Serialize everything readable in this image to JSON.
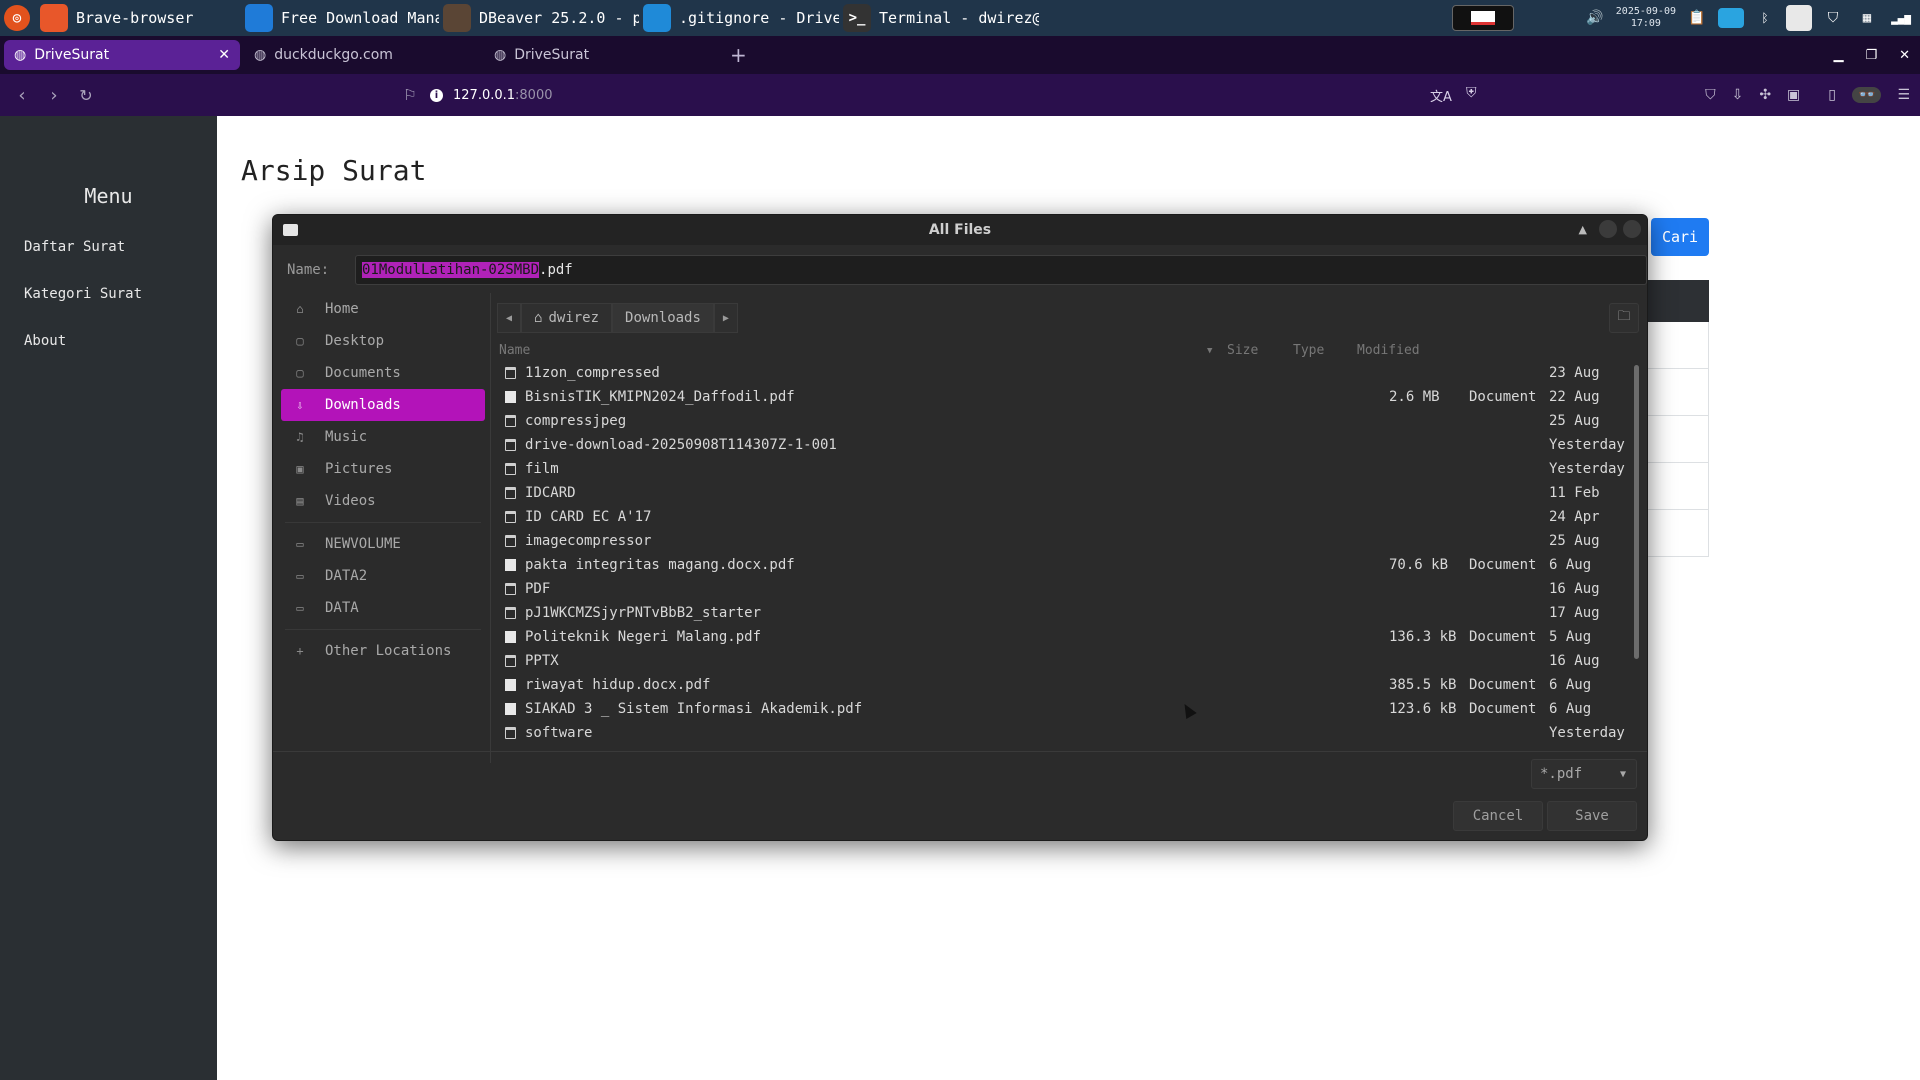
{
  "taskbar": {
    "apps": [
      {
        "label": "Brave-browser",
        "icon": "brave-icon",
        "color": "#e8572a"
      },
      {
        "label": "Free Download Mana…",
        "icon": "download-manager-icon",
        "color": "#1f7bd8"
      },
      {
        "label": "DBeaver 25.2.0 - p…",
        "icon": "dbeaver-icon",
        "color": "#5a4535"
      },
      {
        "label": ".gitignore - Drive…",
        "icon": "vscode-icon",
        "color": "#1f8ad8"
      },
      {
        "label": "Terminal - dwirez@…",
        "icon": "terminal-icon",
        "color": "#333333"
      }
    ],
    "clock_date": "2025-09-09",
    "clock_time": "17:09"
  },
  "browser": {
    "tabs": [
      {
        "label": "DriveSurat",
        "active": true
      },
      {
        "label": "duckduckgo.com",
        "active": false
      },
      {
        "label": "DriveSurat",
        "active": false
      }
    ],
    "url_host": "127.0.0.1",
    "url_port": ":8000"
  },
  "page": {
    "sidebar_title": "Menu",
    "sidebar_links": [
      "Daftar Surat",
      "Kategori Surat",
      "About"
    ],
    "title": "Arsip Surat",
    "search_button": "Cari"
  },
  "dialog": {
    "title": "All Files",
    "name_label": "Name:",
    "name_selected": "01ModulLatihan-02SMBD",
    "name_ext": ".pdf",
    "places": [
      {
        "label": "Home",
        "icon": "home-icon",
        "glyph": "⌂"
      },
      {
        "label": "Desktop",
        "icon": "desktop-icon",
        "glyph": "▢"
      },
      {
        "label": "Documents",
        "icon": "documents-icon",
        "glyph": "▢"
      },
      {
        "label": "Downloads",
        "icon": "downloads-icon",
        "glyph": "⇩",
        "active": true
      },
      {
        "label": "Music",
        "icon": "music-icon",
        "glyph": "♫"
      },
      {
        "label": "Pictures",
        "icon": "pictures-icon",
        "glyph": "▣"
      },
      {
        "label": "Videos",
        "icon": "videos-icon",
        "glyph": "▤"
      }
    ],
    "volumes": [
      {
        "label": "NEWVOLUME",
        "icon": "drive-icon",
        "glyph": "▭"
      },
      {
        "label": "DATA2",
        "icon": "drive-icon",
        "glyph": "▭"
      },
      {
        "label": "DATA",
        "icon": "drive-icon",
        "glyph": "▭"
      }
    ],
    "other_locations": "Other Locations",
    "path": {
      "home": "dwirez",
      "current": "Downloads"
    },
    "columns": {
      "name": "Name",
      "size": "Size",
      "type": "Type",
      "modified": "Modified"
    },
    "files": [
      {
        "name": "11zon_compressed",
        "kind": "folder",
        "size": "",
        "type": "",
        "modified": "23 Aug"
      },
      {
        "name": "BisnisTIK_KMIPN2024_Daffodil.pdf",
        "kind": "doc",
        "size": "2.6 MB",
        "type": "Document",
        "modified": "22 Aug"
      },
      {
        "name": "compressjpeg",
        "kind": "folder",
        "size": "",
        "type": "",
        "modified": "25 Aug"
      },
      {
        "name": "drive-download-20250908T114307Z-1-001",
        "kind": "folder",
        "size": "",
        "type": "",
        "modified": "Yesterday"
      },
      {
        "name": "film",
        "kind": "folder",
        "size": "",
        "type": "",
        "modified": "Yesterday"
      },
      {
        "name": "IDCARD",
        "kind": "folder",
        "size": "",
        "type": "",
        "modified": "11 Feb"
      },
      {
        "name": "ID CARD EC A'17",
        "kind": "folder",
        "size": "",
        "type": "",
        "modified": "24 Apr"
      },
      {
        "name": "imagecompressor",
        "kind": "folder",
        "size": "",
        "type": "",
        "modified": "25 Aug"
      },
      {
        "name": "pakta integritas magang.docx.pdf",
        "kind": "doc",
        "size": "70.6 kB",
        "type": "Document",
        "modified": "6 Aug"
      },
      {
        "name": "PDF",
        "kind": "folder",
        "size": "",
        "type": "",
        "modified": "16 Aug"
      },
      {
        "name": "pJ1WKCMZSjyrPNTvBbB2_starter",
        "kind": "folder",
        "size": "",
        "type": "",
        "modified": "17 Aug"
      },
      {
        "name": "Politeknik Negeri Malang.pdf",
        "kind": "doc",
        "size": "136.3 kB",
        "type": "Document",
        "modified": "5 Aug"
      },
      {
        "name": "PPTX",
        "kind": "folder",
        "size": "",
        "type": "",
        "modified": "16 Aug"
      },
      {
        "name": "riwayat hidup.docx.pdf",
        "kind": "doc",
        "size": "385.5 kB",
        "type": "Document",
        "modified": "6 Aug"
      },
      {
        "name": "SIAKAD 3 _ Sistem Informasi Akademik.pdf",
        "kind": "doc",
        "size": "123.6 kB",
        "type": "Document",
        "modified": "6 Aug"
      },
      {
        "name": "software",
        "kind": "folder",
        "size": "",
        "type": "",
        "modified": "Yesterday"
      }
    ],
    "filter": "*.pdf",
    "cancel_label": "Cancel",
    "save_label": "Save"
  },
  "colors": {
    "accent": "#b313b9",
    "tab_active": "#5b2296",
    "cari_button": "#1f7bf2"
  }
}
